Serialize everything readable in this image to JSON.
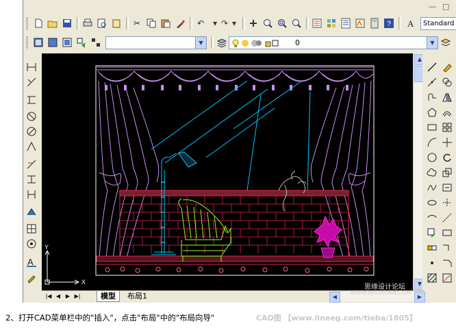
{
  "window": {
    "title_controls": [
      "—",
      "□"
    ],
    "style_value": "Standard"
  },
  "layer": {
    "current_layer": "0"
  },
  "icons": {
    "toolbar1": [
      "new-icon",
      "open-icon",
      "save-icon",
      "plot-icon",
      "plot-preview-icon",
      "publish-icon",
      "cut-icon",
      "copy-icon",
      "paste-icon",
      "match-properties-icon",
      "undo-icon",
      "redo-icon",
      "pan-icon",
      "zoom-realtime-icon",
      "zoom-window-icon",
      "zoom-previous-icon",
      "properties-icon",
      "design-center-icon",
      "tool-palettes-icon",
      "help-icon",
      "text-style-icon"
    ],
    "toolbar2": [
      "layer-manager-icon",
      "lightbulb-icon",
      "sun-icon",
      "lock-icon",
      "color-icon",
      "layer-previous-icon"
    ],
    "left": [
      "line-icon",
      "construction-line-icon",
      "polyline-icon",
      "polygon-icon",
      "rectangle-icon",
      "arc-icon",
      "circle-icon",
      "revision-cloud-icon",
      "spline-icon",
      "ellipse-icon",
      "insert-block-icon",
      "make-block-icon",
      "point-icon",
      "hatch-icon",
      "region-icon",
      "table-icon",
      "text-icon"
    ],
    "right": [
      "erase-icon",
      "copy-object-icon",
      "mirror-icon",
      "offset-icon",
      "array-icon",
      "move-icon",
      "rotate-icon",
      "scale-icon",
      "stretch-icon",
      "trim-icon",
      "extend-icon",
      "break-icon",
      "join-icon",
      "chamfer-icon",
      "fillet-icon",
      "explode-icon"
    ]
  },
  "ucs": {
    "x_label": "X",
    "y_label": "Y"
  },
  "tabs": [
    {
      "label": "模型",
      "active": true
    },
    {
      "label": "布局1",
      "active": false
    }
  ],
  "caption": {
    "text": "2、打开CAD菜单栏中的\"插入\"，点击\"布局\"中的\"布局向导\""
  },
  "watermarks": {
    "site1": "思缘设计论坛",
    "site2": "WWW.MISSYUAN.COM",
    "site3": "CAD图  【www.lineeg.com/tieba/1805】"
  },
  "colors": {
    "canvas": "#000000",
    "curtain": "#c98ef0",
    "bricks": "#e0264a",
    "lamp": "#00c8ff",
    "chair": "#8cff2a",
    "plant": "#ff2ad6"
  }
}
